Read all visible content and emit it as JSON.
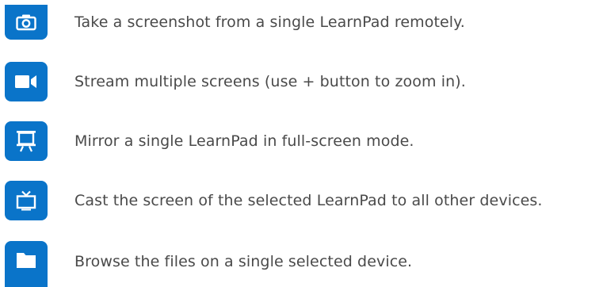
{
  "theme": {
    "tile_color": "#0a74c9",
    "icon_color": "#ffffff",
    "text_color": "#4a4a4a"
  },
  "features": [
    {
      "icon": "camera-icon",
      "text": "Take a screenshot from a single LearnPad remotely."
    },
    {
      "icon": "video-camera-icon",
      "text": "Stream multiple screens (use + button to zoom in)."
    },
    {
      "icon": "presentation-screen-icon",
      "text": "Mirror a single LearnPad in full-screen mode."
    },
    {
      "icon": "tv-cast-icon",
      "text": "Cast the screen of the selected LearnPad to all other devices."
    },
    {
      "icon": "folder-icon",
      "text": "Browse the files on a single selected device."
    }
  ]
}
